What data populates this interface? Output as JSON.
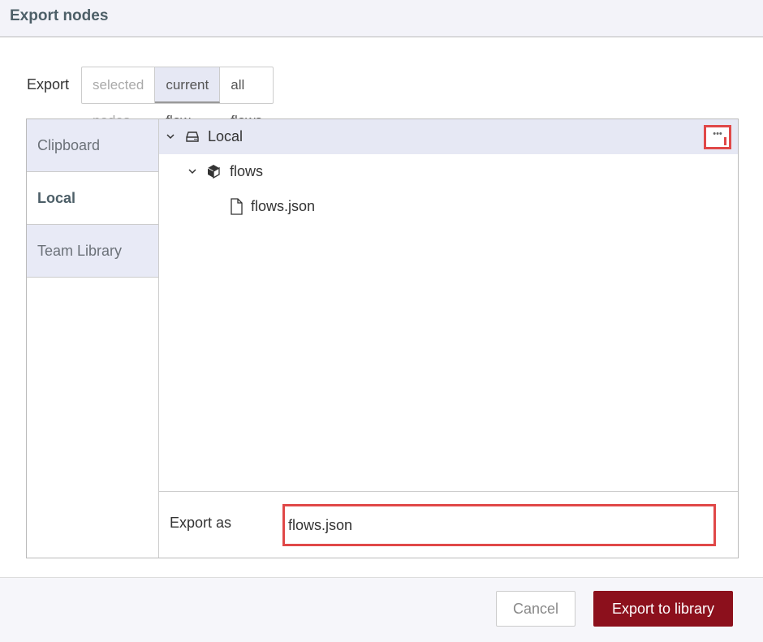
{
  "dialog": {
    "title": "Export nodes"
  },
  "export_options": {
    "label": "Export",
    "options": [
      {
        "label": "selected nodes",
        "state": "disabled"
      },
      {
        "label": "current flow",
        "state": "selected"
      },
      {
        "label": "all flows",
        "state": "normal"
      }
    ]
  },
  "sidebar": {
    "tabs": [
      {
        "label": "Clipboard",
        "active": false
      },
      {
        "label": "Local",
        "active": true
      },
      {
        "label": "Team Library",
        "active": false
      }
    ]
  },
  "tree": {
    "root": {
      "label": "Local",
      "icon": "drive-icon",
      "expanded": true
    },
    "folder": {
      "label": "flows",
      "icon": "cube-icon",
      "expanded": true
    },
    "file": {
      "label": "flows.json",
      "icon": "file-icon"
    },
    "more_button": {
      "icon": "ellipsis-icon"
    }
  },
  "export_as": {
    "label": "Export as",
    "value": "flows.json"
  },
  "footer": {
    "cancel_label": "Cancel",
    "submit_label": "Export to library"
  },
  "colors": {
    "primary": "#8c101c",
    "highlight": "#e04848",
    "selected_bg": "#e6e8f4"
  }
}
